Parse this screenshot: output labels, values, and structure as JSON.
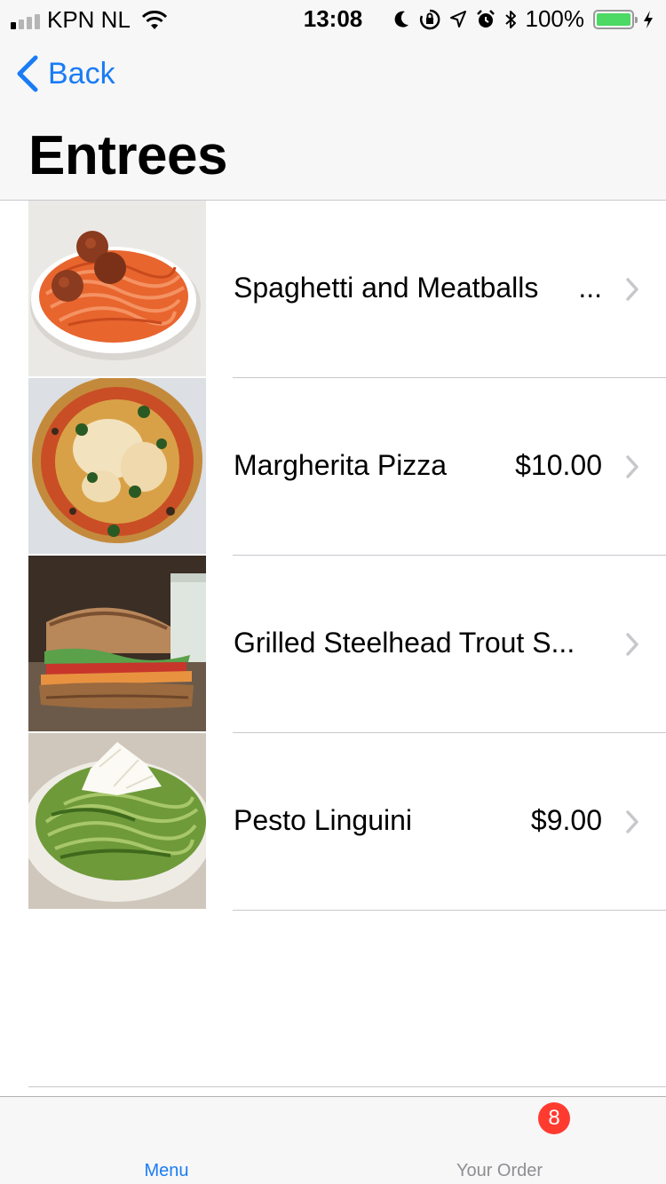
{
  "status_bar": {
    "carrier": "KPN NL",
    "time": "13:08",
    "battery_percent": "100%",
    "battery_level": 1.0,
    "signal_bars_active": 1,
    "icons": [
      "signal-icon",
      "wifi-icon",
      "moon-icon",
      "rotation-lock-icon",
      "location-icon",
      "alarm-icon",
      "bluetooth-icon",
      "battery-icon",
      "charging-icon"
    ]
  },
  "nav": {
    "back_label": "Back",
    "title": "Entrees"
  },
  "items": [
    {
      "name": "Spaghetti and Meatballs",
      "price": "...",
      "image": "spaghetti-meatballs"
    },
    {
      "name": "Margherita Pizza",
      "price": "$10.00",
      "image": "margherita-pizza"
    },
    {
      "name": "Grilled Steelhead Trout S...",
      "price": "",
      "image": "trout-sandwich"
    },
    {
      "name": "Pesto Linguini",
      "price": "$9.00",
      "image": "pesto-linguini"
    }
  ],
  "tabbar": {
    "menu_label": "Menu",
    "order_label": "Your Order",
    "order_badge": "8"
  },
  "colors": {
    "accent": "#1a7cf5",
    "badge": "#ff3b30",
    "battery": "#4cd964"
  }
}
